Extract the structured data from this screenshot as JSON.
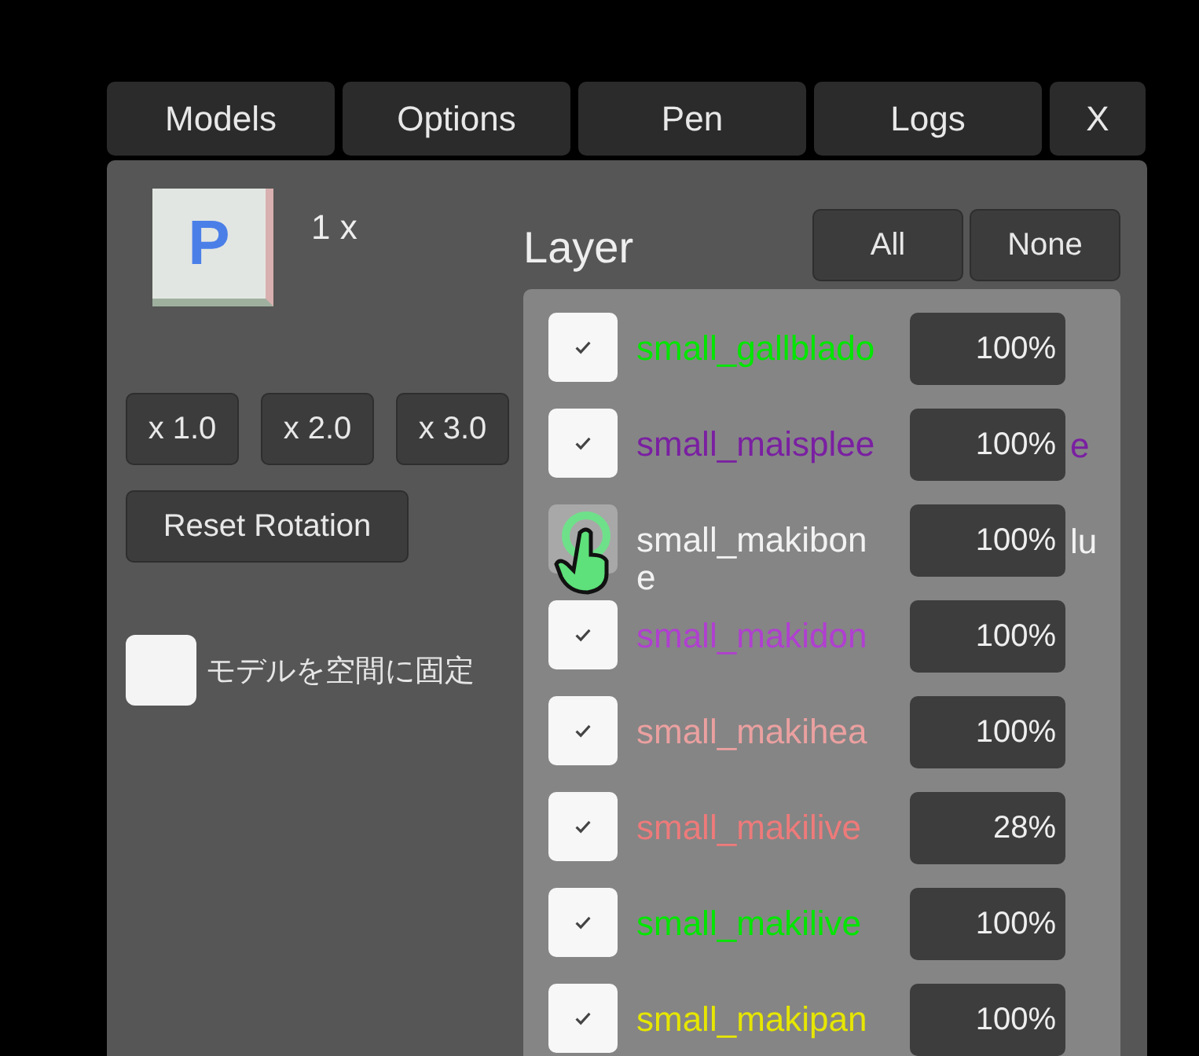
{
  "tabs": [
    {
      "label": "Models",
      "selected": false
    },
    {
      "label": "Options",
      "selected": false
    },
    {
      "label": "Pen",
      "selected": false
    },
    {
      "label": "Logs",
      "selected": false
    }
  ],
  "close": "X",
  "model": {
    "icon_letter": "P",
    "count": "1 x"
  },
  "scale_buttons": [
    "x 1.0",
    "x 2.0",
    "x 3.0"
  ],
  "reset_button": "Reset Rotation",
  "fix_in_space": {
    "label": "モデルを空間に固定",
    "checked": false
  },
  "layer": {
    "title": "Layer",
    "buttons": [
      "All",
      "None"
    ],
    "items": [
      {
        "name": "small_gallblado",
        "checked": true,
        "color": "#00e600",
        "opacity": "100%"
      },
      {
        "name": "small_maisplee",
        "tail": "e",
        "checked": true,
        "color": "#7a1fa2",
        "opacity": "100%"
      },
      {
        "name": "small_makibon",
        "tail": "lu",
        "wrap": "e",
        "checked": false,
        "hovered": true,
        "color": "#f2f2f2",
        "opacity": "100%"
      },
      {
        "name": "small_makidon",
        "checked": true,
        "color": "#b03fd0",
        "opacity": "100%"
      },
      {
        "name": "small_makihea",
        "checked": true,
        "color": "#eba0a0",
        "opacity": "100%"
      },
      {
        "name": "small_makilive",
        "checked": true,
        "color": "#ee7a7a",
        "opacity": "28%"
      },
      {
        "name": "small_makilive",
        "checked": true,
        "color": "#00e600",
        "opacity": "100%"
      },
      {
        "name": "small_makipan",
        "checked": true,
        "color": "#e6e600",
        "opacity": "100%"
      }
    ]
  }
}
